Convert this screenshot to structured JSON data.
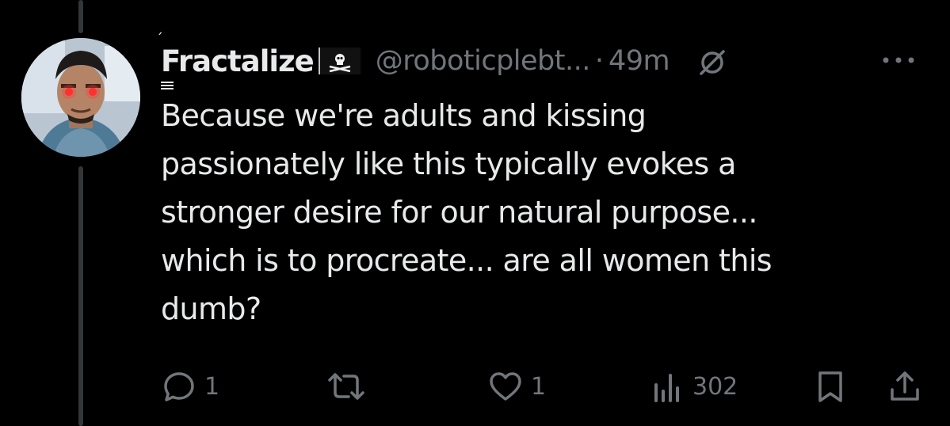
{
  "author": {
    "display_name": "Fractalize",
    "name_accent": "́",
    "flag_emoji": "pirate-flag-icon",
    "handle": "@roboticplebt...",
    "separator": "·",
    "timestamp": "49m"
  },
  "tweet": {
    "lines": [
      "Because we're adults and kissing",
      "passionately like this typically evokes a",
      "stronger desire for our natural purpose...",
      "which is to procreate... are all women this",
      "dumb?"
    ]
  },
  "actions": {
    "reply_count": "1",
    "retweet_count": "",
    "like_count": "1",
    "views_count": "302"
  },
  "colors": {
    "background": "#000000",
    "text_primary": "#e7e9ea",
    "text_secondary": "#71767b",
    "thread_line": "#333639"
  }
}
